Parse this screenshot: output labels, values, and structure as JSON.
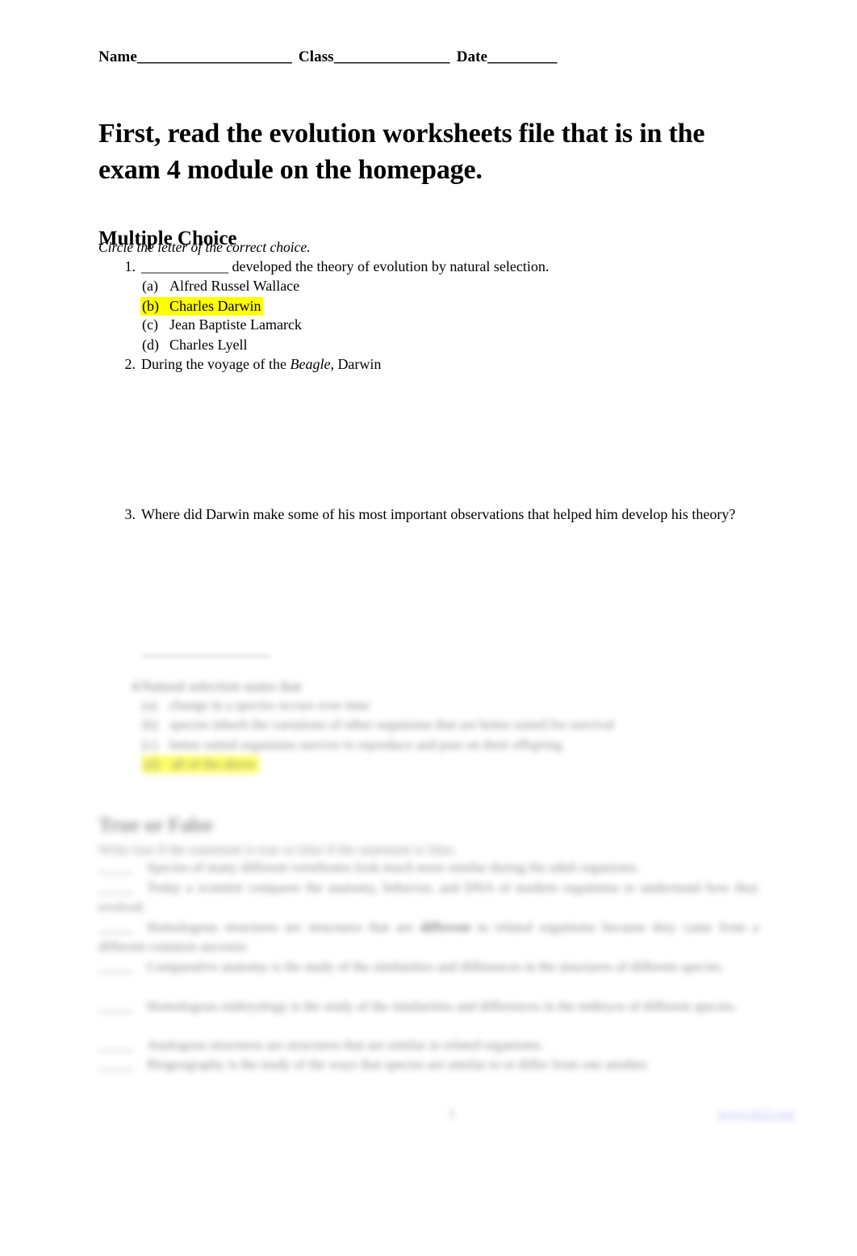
{
  "document": {
    "header": {
      "name_label": "Name",
      "name_blank": "____________________",
      "class_label": "Class",
      "class_blank": "_______________",
      "date_label": "Date",
      "date_blank": "_________"
    },
    "title": "First, read the evolution worksheets file that is in the exam 4 module on the homepage.",
    "sections": [
      {
        "heading": "Multiple Choice",
        "instruction": "Circle the letter of the correct choice.",
        "questions": [
          {
            "number": "1.",
            "text": "____________ developed the theory of evolution by natural selection.",
            "options": [
              {
                "label": "(a)",
                "text": "Alfred Russel Wallace",
                "highlighted": false
              },
              {
                "label": "(b)",
                "text": "Charles Darwin",
                "highlighted": true
              },
              {
                "label": "(c)",
                "text": "Jean Baptiste Lamarck",
                "highlighted": false
              },
              {
                "label": "(d)",
                "text": "Charles Lyell",
                "highlighted": false
              }
            ]
          },
          {
            "number": "2.",
            "text_before_italic": "During the voyage of the ",
            "italic_word": "Beagle",
            "text_after_italic": ", Darwin",
            "options": []
          },
          {
            "number": "3.",
            "text": "Where did Darwin make some of his most important observations that helped him develop his theory?",
            "options": []
          }
        ]
      }
    ],
    "obscured": {
      "note": "regions below are visually blurred in the source image and not legible",
      "question4": {
        "number": "4.",
        "text": "Natural selection states that",
        "options": [
          {
            "label": "(a)",
            "text": "change in a species occurs over time",
            "highlighted": false
          },
          {
            "label": "(b)",
            "text": "species inherit the variations of other organisms that are better suited for survival",
            "highlighted": false
          },
          {
            "label": "(c)",
            "text": "better suited organisms survive to reproduce and pass on their offspring",
            "highlighted": false
          },
          {
            "label": "(d)",
            "text": "all of the above",
            "highlighted": true
          }
        ]
      },
      "true_false_section": {
        "heading": "True or False",
        "instruction": "Write true if the statement is true or false if the statement is false.",
        "items": [
          {
            "blank": "_____",
            "text": "Species of many different vertebrates look much more similar during the adult organisms."
          },
          {
            "blank": "_____",
            "text": "Today a scientist compares the anatomy, behavior, and DNA of modern organisms to understand how they evolved."
          },
          {
            "blank": "_____",
            "text": "Homologous structures are structures that are ",
            "bold": "different",
            "text2": " in related organisms because they came from a different common ancestor."
          },
          {
            "blank": "_____",
            "text": "Comparative anatomy is the study of the similarities and differences in the structures of different species."
          },
          {
            "blank": "_____",
            "text": "Homologous embryology is the study of the similarities and differences in the embryos of different species."
          },
          {
            "blank": "_____",
            "text": "Analogous structures are structures that are similar in related organisms."
          },
          {
            "blank": "_____",
            "text": "Biogeography is the study of the ways that species are similar to or differ from one another."
          }
        ]
      },
      "footer": {
        "page_number": "1",
        "link_text": "www.ck12.org"
      }
    }
  }
}
